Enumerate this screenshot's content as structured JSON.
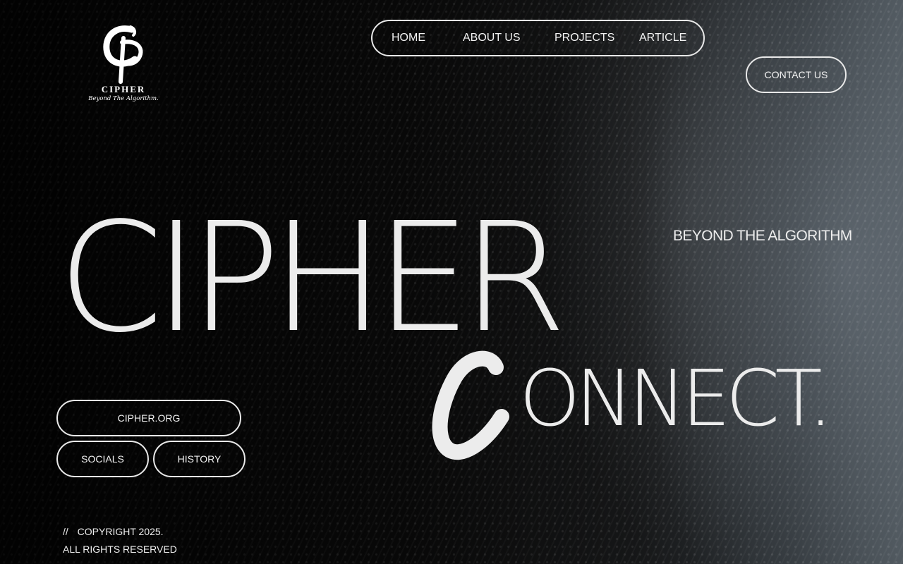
{
  "brand": {
    "logo_name": "CIPHER",
    "logo_tagline": "Beyond The Algorithm."
  },
  "nav": {
    "items": [
      {
        "label": "HOME"
      },
      {
        "label": "ABOUT US"
      },
      {
        "label": "PROJECTS"
      },
      {
        "label": "ARTICLE"
      }
    ],
    "contact_label": "CONTACT US"
  },
  "hero": {
    "title": "CIPHER",
    "tagline": "BEYOND  THE ALGORITHM",
    "connect_initial": "C",
    "connect_rest": "ONNECT."
  },
  "links": {
    "org": "CIPHER.ORG",
    "socials": "SOCIALS",
    "history": "HISTORY"
  },
  "footer": {
    "slashes": "//",
    "copyright": "COPYRIGHT 2025.",
    "rights": "ALL RIGHTS RESERVED"
  },
  "colors": {
    "text": "#ececec",
    "border": "#e9e9e9",
    "background": "#050505"
  }
}
